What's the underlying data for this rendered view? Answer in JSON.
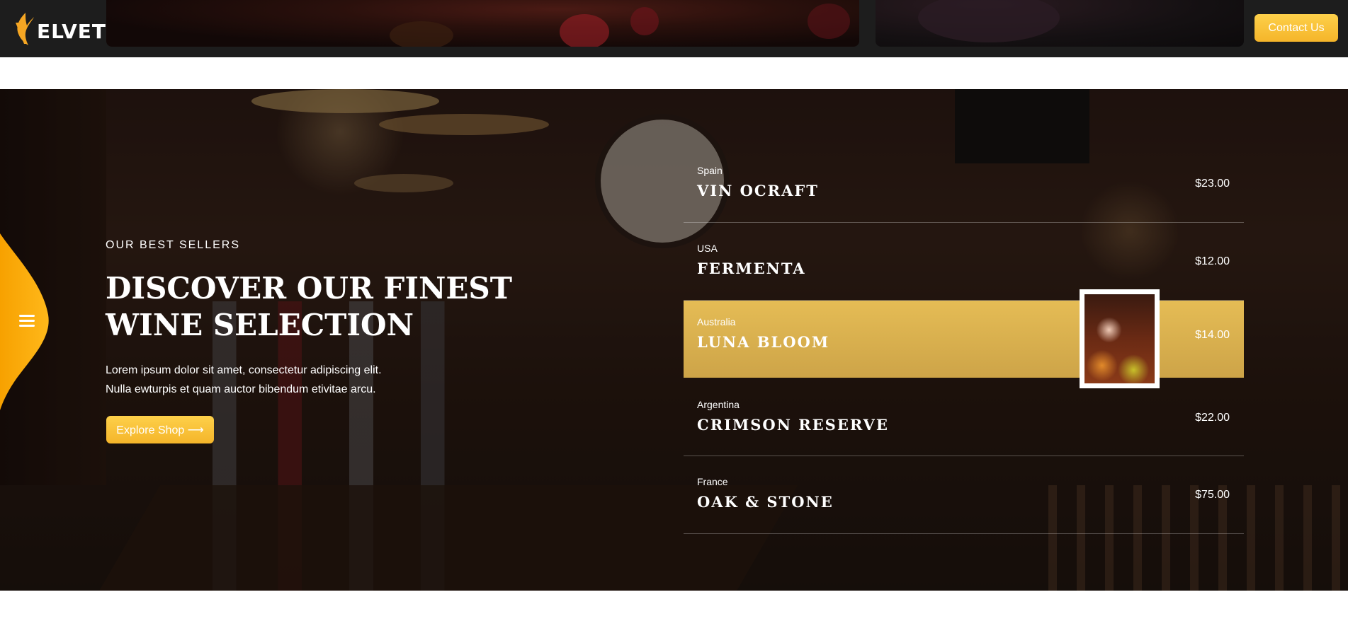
{
  "header": {
    "logo_text": "ELVET",
    "contact_label": "Contact Us"
  },
  "hero": {
    "eyebrow": "OUR BEST SELLERS",
    "title": "DISCOVER OUR FINEST WINE SELECTION",
    "description_line1": "Lorem ipsum dolor sit amet, consectetur adipiscing elit.",
    "description_line2": "Nulla ewturpis et quam auctor bibendum etivitae arcu.",
    "cta_label": "Explore Shop ⟶"
  },
  "wines": [
    {
      "country": "Spain",
      "name": "VIN OCRAFT",
      "price": "$23.00",
      "active": false
    },
    {
      "country": "USA",
      "name": "FERMENTA",
      "price": "$12.00",
      "active": false
    },
    {
      "country": "Australia",
      "name": "LUNA BLOOM",
      "price": "$14.00",
      "active": true
    },
    {
      "country": "Argentina",
      "name": "CRIMSON RESERVE",
      "price": "$22.00",
      "active": false
    },
    {
      "country": "France",
      "name": "OAK & STONE",
      "price": "$75.00",
      "active": false
    }
  ],
  "colors": {
    "accent": "#f8c23a",
    "active_row": "#d9b04e",
    "header_bg": "#1d1d1d"
  },
  "icons": [
    "logo-icon",
    "menu-icon"
  ]
}
